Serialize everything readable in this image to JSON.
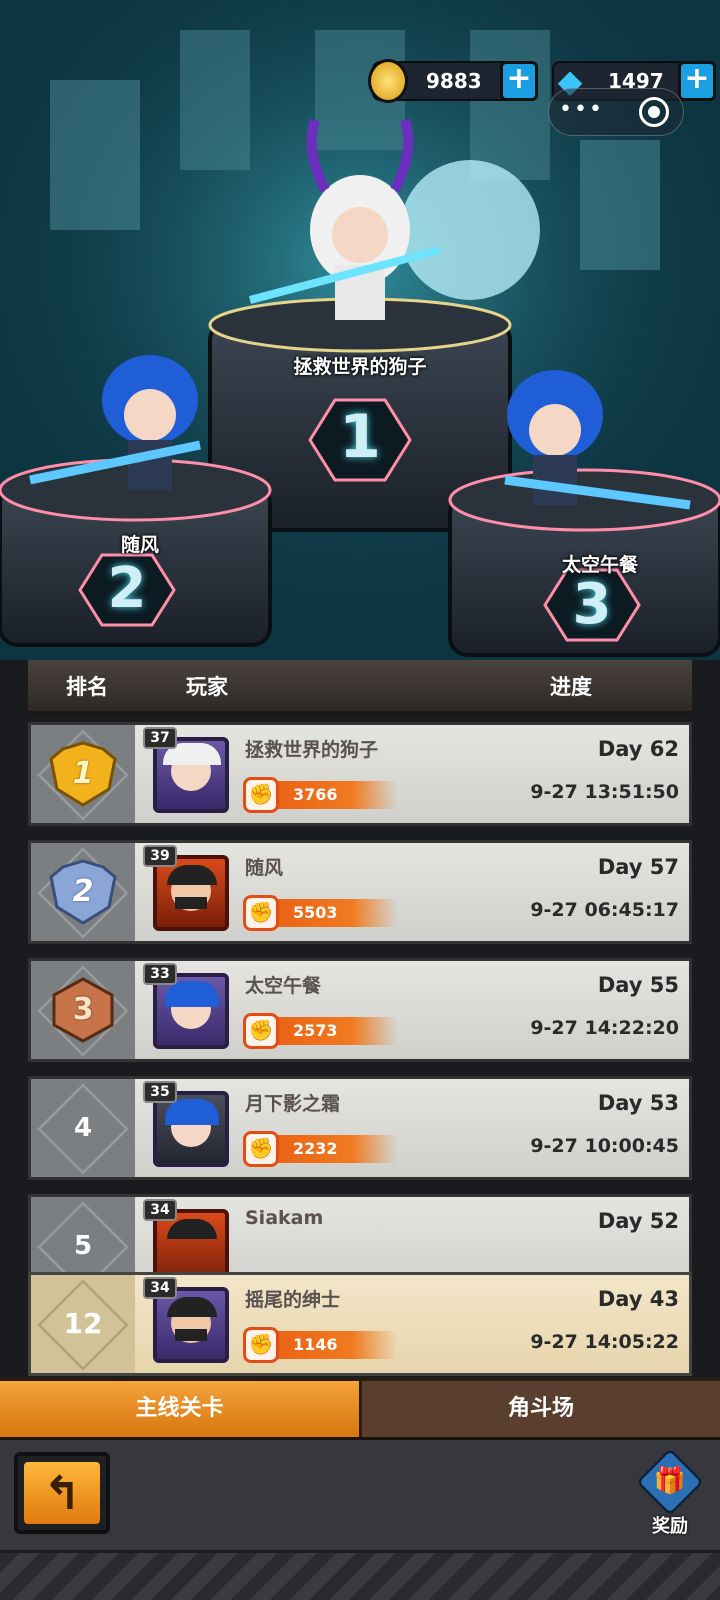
{
  "resources": {
    "gold": "9883",
    "gems": "1497"
  },
  "podium": {
    "first_name": "拯救世界的狗子",
    "second_name": "随风",
    "third_name": "太空午餐",
    "first_num": "1",
    "second_num": "2",
    "third_num": "3"
  },
  "table_header": {
    "rank": "排名",
    "player": "玩家",
    "progress": "进度"
  },
  "rows": [
    {
      "rank": "1",
      "level": "37",
      "name": "拯救世界的狗子",
      "power": "3766",
      "day": "Day 62",
      "time": "9-27 13:51:50"
    },
    {
      "rank": "2",
      "level": "39",
      "name": "随风",
      "power": "5503",
      "day": "Day 57",
      "time": "9-27 06:45:17"
    },
    {
      "rank": "3",
      "level": "33",
      "name": "太空午餐",
      "power": "2573",
      "day": "Day 55",
      "time": "9-27 14:22:20"
    },
    {
      "rank": "4",
      "level": "35",
      "name": "月下影之霜",
      "power": "2232",
      "day": "Day 53",
      "time": "9-27 10:00:45"
    },
    {
      "rank": "5",
      "level": "34",
      "name": "Siakam",
      "power": "",
      "day": "Day 52",
      "time": ""
    }
  ],
  "my_row": {
    "rank": "12",
    "level": "34",
    "name": "摇尾的绅士",
    "power": "1146",
    "day": "Day 43",
    "time": "9-27 14:05:22"
  },
  "tabs": {
    "main": "主线关卡",
    "arena": "角斗场"
  },
  "bottom": {
    "reward_label": "奖励"
  },
  "colors": {
    "gold_badge": "#f2b21c",
    "silver_badge": "#8aa6d8",
    "bronze_badge": "#c8744a",
    "power_bar": "#e85a10",
    "active_tab": "#f4a23a",
    "plus_button": "#1c9fe0"
  }
}
